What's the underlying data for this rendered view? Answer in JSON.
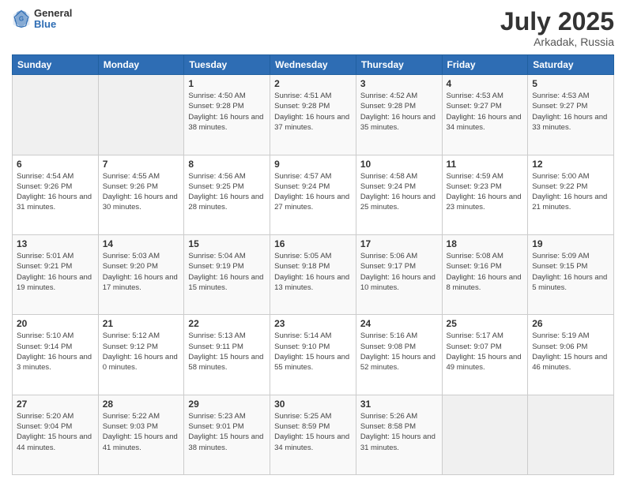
{
  "header": {
    "logo": {
      "general": "General",
      "blue": "Blue"
    },
    "title": "July 2025",
    "location": "Arkadak, Russia"
  },
  "weekdays": [
    "Sunday",
    "Monday",
    "Tuesday",
    "Wednesday",
    "Thursday",
    "Friday",
    "Saturday"
  ],
  "weeks": [
    [
      null,
      null,
      {
        "day": 1,
        "sunrise": "4:50 AM",
        "sunset": "9:28 PM",
        "daylight": "16 hours and 38 minutes."
      },
      {
        "day": 2,
        "sunrise": "4:51 AM",
        "sunset": "9:28 PM",
        "daylight": "16 hours and 37 minutes."
      },
      {
        "day": 3,
        "sunrise": "4:52 AM",
        "sunset": "9:28 PM",
        "daylight": "16 hours and 35 minutes."
      },
      {
        "day": 4,
        "sunrise": "4:53 AM",
        "sunset": "9:27 PM",
        "daylight": "16 hours and 34 minutes."
      },
      {
        "day": 5,
        "sunrise": "4:53 AM",
        "sunset": "9:27 PM",
        "daylight": "16 hours and 33 minutes."
      }
    ],
    [
      {
        "day": 6,
        "sunrise": "4:54 AM",
        "sunset": "9:26 PM",
        "daylight": "16 hours and 31 minutes."
      },
      {
        "day": 7,
        "sunrise": "4:55 AM",
        "sunset": "9:26 PM",
        "daylight": "16 hours and 30 minutes."
      },
      {
        "day": 8,
        "sunrise": "4:56 AM",
        "sunset": "9:25 PM",
        "daylight": "16 hours and 28 minutes."
      },
      {
        "day": 9,
        "sunrise": "4:57 AM",
        "sunset": "9:24 PM",
        "daylight": "16 hours and 27 minutes."
      },
      {
        "day": 10,
        "sunrise": "4:58 AM",
        "sunset": "9:24 PM",
        "daylight": "16 hours and 25 minutes."
      },
      {
        "day": 11,
        "sunrise": "4:59 AM",
        "sunset": "9:23 PM",
        "daylight": "16 hours and 23 minutes."
      },
      {
        "day": 12,
        "sunrise": "5:00 AM",
        "sunset": "9:22 PM",
        "daylight": "16 hours and 21 minutes."
      }
    ],
    [
      {
        "day": 13,
        "sunrise": "5:01 AM",
        "sunset": "9:21 PM",
        "daylight": "16 hours and 19 minutes."
      },
      {
        "day": 14,
        "sunrise": "5:03 AM",
        "sunset": "9:20 PM",
        "daylight": "16 hours and 17 minutes."
      },
      {
        "day": 15,
        "sunrise": "5:04 AM",
        "sunset": "9:19 PM",
        "daylight": "16 hours and 15 minutes."
      },
      {
        "day": 16,
        "sunrise": "5:05 AM",
        "sunset": "9:18 PM",
        "daylight": "16 hours and 13 minutes."
      },
      {
        "day": 17,
        "sunrise": "5:06 AM",
        "sunset": "9:17 PM",
        "daylight": "16 hours and 10 minutes."
      },
      {
        "day": 18,
        "sunrise": "5:08 AM",
        "sunset": "9:16 PM",
        "daylight": "16 hours and 8 minutes."
      },
      {
        "day": 19,
        "sunrise": "5:09 AM",
        "sunset": "9:15 PM",
        "daylight": "16 hours and 5 minutes."
      }
    ],
    [
      {
        "day": 20,
        "sunrise": "5:10 AM",
        "sunset": "9:14 PM",
        "daylight": "16 hours and 3 minutes."
      },
      {
        "day": 21,
        "sunrise": "5:12 AM",
        "sunset": "9:12 PM",
        "daylight": "16 hours and 0 minutes."
      },
      {
        "day": 22,
        "sunrise": "5:13 AM",
        "sunset": "9:11 PM",
        "daylight": "15 hours and 58 minutes."
      },
      {
        "day": 23,
        "sunrise": "5:14 AM",
        "sunset": "9:10 PM",
        "daylight": "15 hours and 55 minutes."
      },
      {
        "day": 24,
        "sunrise": "5:16 AM",
        "sunset": "9:08 PM",
        "daylight": "15 hours and 52 minutes."
      },
      {
        "day": 25,
        "sunrise": "5:17 AM",
        "sunset": "9:07 PM",
        "daylight": "15 hours and 49 minutes."
      },
      {
        "day": 26,
        "sunrise": "5:19 AM",
        "sunset": "9:06 PM",
        "daylight": "15 hours and 46 minutes."
      }
    ],
    [
      {
        "day": 27,
        "sunrise": "5:20 AM",
        "sunset": "9:04 PM",
        "daylight": "15 hours and 44 minutes."
      },
      {
        "day": 28,
        "sunrise": "5:22 AM",
        "sunset": "9:03 PM",
        "daylight": "15 hours and 41 minutes."
      },
      {
        "day": 29,
        "sunrise": "5:23 AM",
        "sunset": "9:01 PM",
        "daylight": "15 hours and 38 minutes."
      },
      {
        "day": 30,
        "sunrise": "5:25 AM",
        "sunset": "8:59 PM",
        "daylight": "15 hours and 34 minutes."
      },
      {
        "day": 31,
        "sunrise": "5:26 AM",
        "sunset": "8:58 PM",
        "daylight": "15 hours and 31 minutes."
      },
      null,
      null
    ]
  ]
}
